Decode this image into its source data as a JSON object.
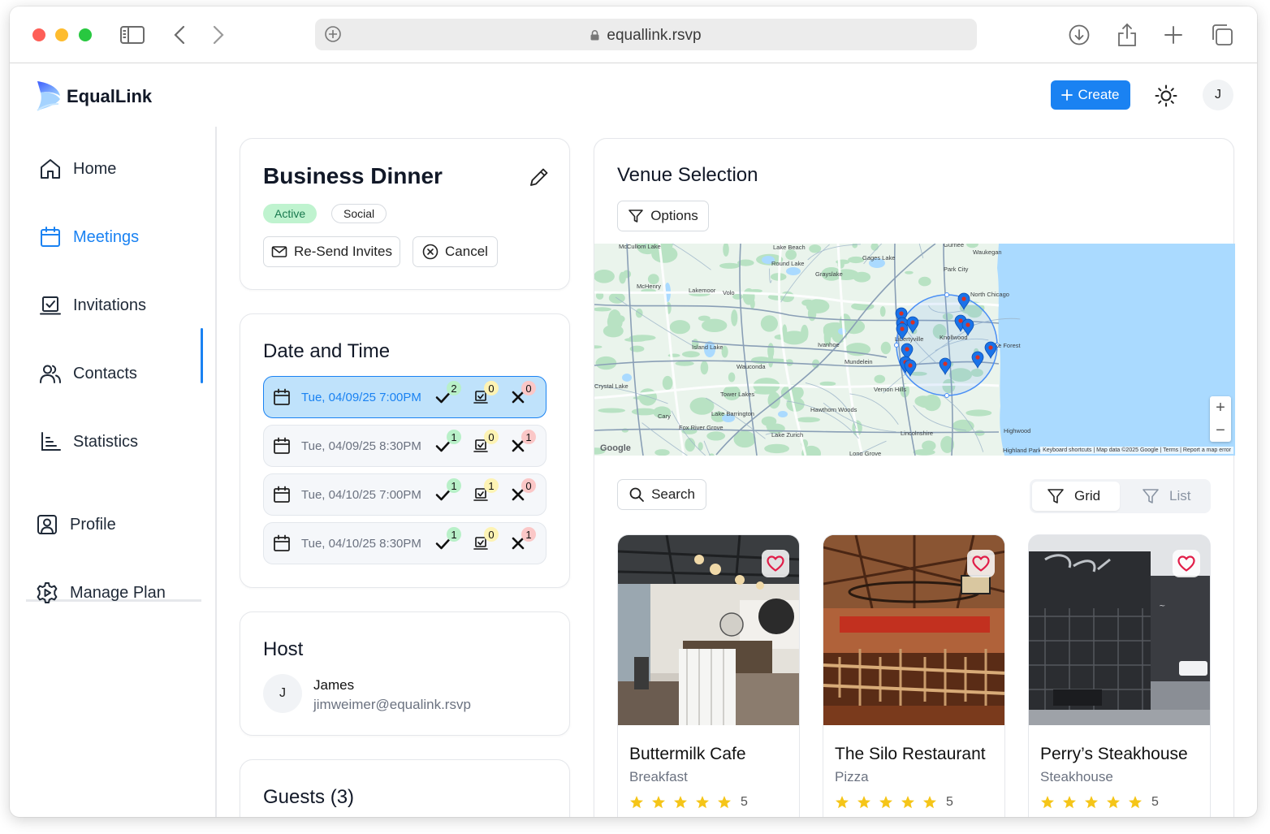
{
  "browser": {
    "url": "equallink.rsvp"
  },
  "app": {
    "brand": "EqualLink",
    "create_label": "Create",
    "user_initial": "J"
  },
  "sidebar": {
    "items": [
      {
        "label": "Home",
        "icon": "home-icon"
      },
      {
        "label": "Meetings",
        "icon": "calendar-icon",
        "active": true
      },
      {
        "label": "Invitations",
        "icon": "invitation-icon"
      },
      {
        "label": "Contacts",
        "icon": "contacts-icon"
      },
      {
        "label": "Statistics",
        "icon": "chart-icon"
      },
      {
        "label": "Profile",
        "icon": "profile-icon"
      },
      {
        "label": "Manage Plan",
        "icon": "gear-icon"
      }
    ]
  },
  "meeting": {
    "title": "Business Dinner",
    "status_badge": "Active",
    "type_badge": "Social",
    "resend_label": "Re-Send Invites",
    "cancel_label": "Cancel"
  },
  "datetime": {
    "title": "Date and Time",
    "slots": [
      {
        "label": "Tue, 04/09/25 7:00PM",
        "accepted": "2",
        "pending": "0",
        "declined": "0",
        "selected": true
      },
      {
        "label": "Tue, 04/09/25 8:30PM",
        "accepted": "1",
        "pending": "0",
        "declined": "1"
      },
      {
        "label": "Tue, 04/10/25 7:00PM",
        "accepted": "1",
        "pending": "1",
        "declined": "0"
      },
      {
        "label": "Tue, 04/10/25 8:30PM",
        "accepted": "1",
        "pending": "0",
        "declined": "1"
      }
    ]
  },
  "host": {
    "title": "Host",
    "initial": "J",
    "name": "James",
    "email": "jimweimer@equalink.rsvp"
  },
  "guests": {
    "title": "Guests (3)"
  },
  "venue": {
    "title": "Venue Selection",
    "options_label": "Options",
    "search_label": "Search",
    "grid_label": "Grid",
    "list_label": "List",
    "map": {
      "labels": [
        "McCullom Lake",
        "Lake Beach",
        "Round Lake",
        "Gurnee",
        "Waukegan",
        "Gages Lake",
        "Park City",
        "Grayslake",
        "McHenry",
        "Lakemoor",
        "Volo",
        "North Chicago",
        "Island Lake",
        "Libertyville",
        "Knollwood",
        "Lake Forest",
        "Ivanhoe",
        "Mundelein",
        "Wauconda",
        "Crystal Lake",
        "Vernon Hills",
        "Tower Lakes",
        "Cary",
        "Lake Barrington",
        "Hawthorn Woods",
        "Fox River Grove",
        "Lake Zurich",
        "Lincolnshire",
        "Highwood",
        "Highland Park",
        "Long Grove"
      ],
      "attribution": "Keyboard shortcuts | Map data ©2025 Google | Terms | Report a map error",
      "google": "Google",
      "zoom_in": "+",
      "zoom_out": "−"
    },
    "venues": [
      {
        "name": "Buttermilk Cafe",
        "cuisine": "Breakfast",
        "rating": "5",
        "stars": 5
      },
      {
        "name": "The Silo Restaurant",
        "cuisine": "Pizza",
        "rating": "5",
        "stars": 5
      },
      {
        "name": "Perry’s Steakhouse",
        "cuisine": "Steakhouse",
        "rating": "5",
        "stars": 5
      }
    ]
  },
  "colors": {
    "accent": "#1a82f2",
    "active_badge": "#bff3cf",
    "star": "#f5c518",
    "heart": "#e11d48"
  }
}
